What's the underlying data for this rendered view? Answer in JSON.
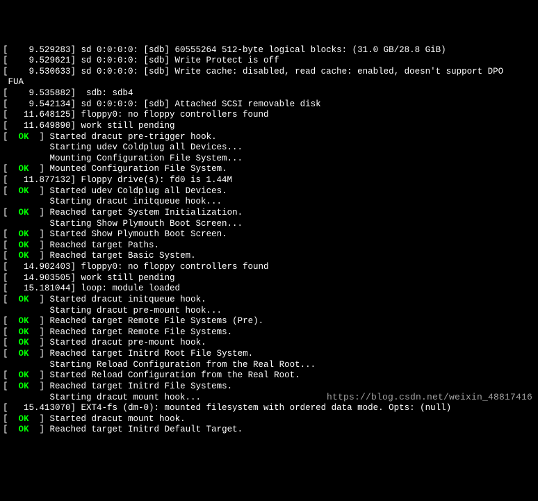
{
  "lines": [
    {
      "type": "plain",
      "text": "[    9.529283] sd 0:0:0:0: [sdb] 60555264 512-byte logical blocks: (31.0 GB/28.8 GiB)"
    },
    {
      "type": "plain",
      "text": "[    9.529621] sd 0:0:0:0: [sdb] Write Protect is off"
    },
    {
      "type": "plain",
      "text": "[    9.530633] sd 0:0:0:0: [sdb] Write cache: disabled, read cache: enabled, doesn't support DPO"
    },
    {
      "type": "plain",
      "text": " FUA"
    },
    {
      "type": "plain",
      "text": "[    9.535882]  sdb: sdb4"
    },
    {
      "type": "plain",
      "text": "[    9.542134] sd 0:0:0:0: [sdb] Attached SCSI removable disk"
    },
    {
      "type": "plain",
      "text": "[   11.648125] floppy0: no floppy controllers found"
    },
    {
      "type": "plain",
      "text": "[   11.649890] work still pending"
    },
    {
      "type": "ok",
      "text": "Started dracut pre-trigger hook."
    },
    {
      "type": "indent",
      "text": "Starting udev Coldplug all Devices..."
    },
    {
      "type": "indent",
      "text": "Mounting Configuration File System..."
    },
    {
      "type": "ok",
      "text": "Mounted Configuration File System."
    },
    {
      "type": "plain",
      "text": "[   11.877132] Floppy drive(s): fd0 is 1.44M"
    },
    {
      "type": "ok",
      "text": "Started udev Coldplug all Devices."
    },
    {
      "type": "indent",
      "text": "Starting dracut initqueue hook..."
    },
    {
      "type": "ok",
      "text": "Reached target System Initialization."
    },
    {
      "type": "indent",
      "text": "Starting Show Plymouth Boot Screen..."
    },
    {
      "type": "ok",
      "text": "Started Show Plymouth Boot Screen."
    },
    {
      "type": "ok",
      "text": "Reached target Paths."
    },
    {
      "type": "ok",
      "text": "Reached target Basic System."
    },
    {
      "type": "plain",
      "text": "[   14.902403] floppy0: no floppy controllers found"
    },
    {
      "type": "plain",
      "text": "[   14.903505] work still pending"
    },
    {
      "type": "plain",
      "text": "[   15.181044] loop: module loaded"
    },
    {
      "type": "ok",
      "text": "Started dracut initqueue hook."
    },
    {
      "type": "indent",
      "text": "Starting dracut pre-mount hook..."
    },
    {
      "type": "ok",
      "text": "Reached target Remote File Systems (Pre)."
    },
    {
      "type": "ok",
      "text": "Reached target Remote File Systems."
    },
    {
      "type": "ok",
      "text": "Started dracut pre-mount hook."
    },
    {
      "type": "ok",
      "text": "Reached target Initrd Root File System."
    },
    {
      "type": "indent",
      "text": "Starting Reload Configuration from the Real Root..."
    },
    {
      "type": "ok",
      "text": "Started Reload Configuration from the Real Root."
    },
    {
      "type": "ok",
      "text": "Reached target Initrd File Systems."
    },
    {
      "type": "indent",
      "text": "Starting dracut mount hook..."
    },
    {
      "type": "plain",
      "text": "[   15.413070] EXT4-fs (dm-0): mounted filesystem with ordered data mode. Opts: (null)"
    },
    {
      "type": "ok",
      "text": "Started dracut mount hook."
    },
    {
      "type": "ok",
      "text": "Reached target Initrd Default Target."
    }
  ],
  "ok_label": "OK",
  "watermark": "https://blog.csdn.net/weixin_48817416"
}
